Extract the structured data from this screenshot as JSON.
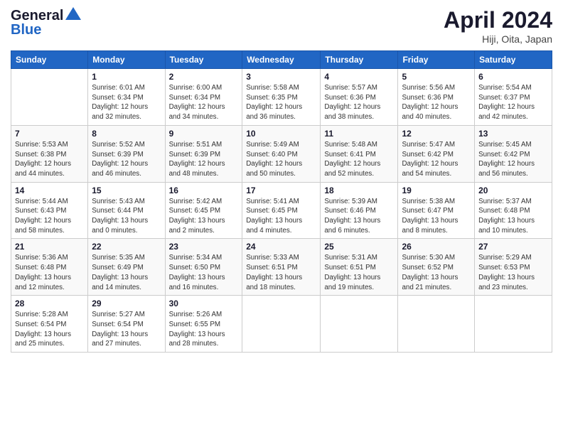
{
  "header": {
    "logo_line1": "General",
    "logo_line2": "Blue",
    "title": "April 2024",
    "subtitle": "Hiji, Oita, Japan"
  },
  "calendar": {
    "weekdays": [
      "Sunday",
      "Monday",
      "Tuesday",
      "Wednesday",
      "Thursday",
      "Friday",
      "Saturday"
    ],
    "rows": [
      [
        {
          "day": "",
          "info": ""
        },
        {
          "day": "1",
          "info": "Sunrise: 6:01 AM\nSunset: 6:34 PM\nDaylight: 12 hours\nand 32 minutes."
        },
        {
          "day": "2",
          "info": "Sunrise: 6:00 AM\nSunset: 6:34 PM\nDaylight: 12 hours\nand 34 minutes."
        },
        {
          "day": "3",
          "info": "Sunrise: 5:58 AM\nSunset: 6:35 PM\nDaylight: 12 hours\nand 36 minutes."
        },
        {
          "day": "4",
          "info": "Sunrise: 5:57 AM\nSunset: 6:36 PM\nDaylight: 12 hours\nand 38 minutes."
        },
        {
          "day": "5",
          "info": "Sunrise: 5:56 AM\nSunset: 6:36 PM\nDaylight: 12 hours\nand 40 minutes."
        },
        {
          "day": "6",
          "info": "Sunrise: 5:54 AM\nSunset: 6:37 PM\nDaylight: 12 hours\nand 42 minutes."
        }
      ],
      [
        {
          "day": "7",
          "info": "Sunrise: 5:53 AM\nSunset: 6:38 PM\nDaylight: 12 hours\nand 44 minutes."
        },
        {
          "day": "8",
          "info": "Sunrise: 5:52 AM\nSunset: 6:39 PM\nDaylight: 12 hours\nand 46 minutes."
        },
        {
          "day": "9",
          "info": "Sunrise: 5:51 AM\nSunset: 6:39 PM\nDaylight: 12 hours\nand 48 minutes."
        },
        {
          "day": "10",
          "info": "Sunrise: 5:49 AM\nSunset: 6:40 PM\nDaylight: 12 hours\nand 50 minutes."
        },
        {
          "day": "11",
          "info": "Sunrise: 5:48 AM\nSunset: 6:41 PM\nDaylight: 12 hours\nand 52 minutes."
        },
        {
          "day": "12",
          "info": "Sunrise: 5:47 AM\nSunset: 6:42 PM\nDaylight: 12 hours\nand 54 minutes."
        },
        {
          "day": "13",
          "info": "Sunrise: 5:45 AM\nSunset: 6:42 PM\nDaylight: 12 hours\nand 56 minutes."
        }
      ],
      [
        {
          "day": "14",
          "info": "Sunrise: 5:44 AM\nSunset: 6:43 PM\nDaylight: 12 hours\nand 58 minutes."
        },
        {
          "day": "15",
          "info": "Sunrise: 5:43 AM\nSunset: 6:44 PM\nDaylight: 13 hours\nand 0 minutes."
        },
        {
          "day": "16",
          "info": "Sunrise: 5:42 AM\nSunset: 6:45 PM\nDaylight: 13 hours\nand 2 minutes."
        },
        {
          "day": "17",
          "info": "Sunrise: 5:41 AM\nSunset: 6:45 PM\nDaylight: 13 hours\nand 4 minutes."
        },
        {
          "day": "18",
          "info": "Sunrise: 5:39 AM\nSunset: 6:46 PM\nDaylight: 13 hours\nand 6 minutes."
        },
        {
          "day": "19",
          "info": "Sunrise: 5:38 AM\nSunset: 6:47 PM\nDaylight: 13 hours\nand 8 minutes."
        },
        {
          "day": "20",
          "info": "Sunrise: 5:37 AM\nSunset: 6:48 PM\nDaylight: 13 hours\nand 10 minutes."
        }
      ],
      [
        {
          "day": "21",
          "info": "Sunrise: 5:36 AM\nSunset: 6:48 PM\nDaylight: 13 hours\nand 12 minutes."
        },
        {
          "day": "22",
          "info": "Sunrise: 5:35 AM\nSunset: 6:49 PM\nDaylight: 13 hours\nand 14 minutes."
        },
        {
          "day": "23",
          "info": "Sunrise: 5:34 AM\nSunset: 6:50 PM\nDaylight: 13 hours\nand 16 minutes."
        },
        {
          "day": "24",
          "info": "Sunrise: 5:33 AM\nSunset: 6:51 PM\nDaylight: 13 hours\nand 18 minutes."
        },
        {
          "day": "25",
          "info": "Sunrise: 5:31 AM\nSunset: 6:51 PM\nDaylight: 13 hours\nand 19 minutes."
        },
        {
          "day": "26",
          "info": "Sunrise: 5:30 AM\nSunset: 6:52 PM\nDaylight: 13 hours\nand 21 minutes."
        },
        {
          "day": "27",
          "info": "Sunrise: 5:29 AM\nSunset: 6:53 PM\nDaylight: 13 hours\nand 23 minutes."
        }
      ],
      [
        {
          "day": "28",
          "info": "Sunrise: 5:28 AM\nSunset: 6:54 PM\nDaylight: 13 hours\nand 25 minutes."
        },
        {
          "day": "29",
          "info": "Sunrise: 5:27 AM\nSunset: 6:54 PM\nDaylight: 13 hours\nand 27 minutes."
        },
        {
          "day": "30",
          "info": "Sunrise: 5:26 AM\nSunset: 6:55 PM\nDaylight: 13 hours\nand 28 minutes."
        },
        {
          "day": "",
          "info": ""
        },
        {
          "day": "",
          "info": ""
        },
        {
          "day": "",
          "info": ""
        },
        {
          "day": "",
          "info": ""
        }
      ]
    ]
  }
}
